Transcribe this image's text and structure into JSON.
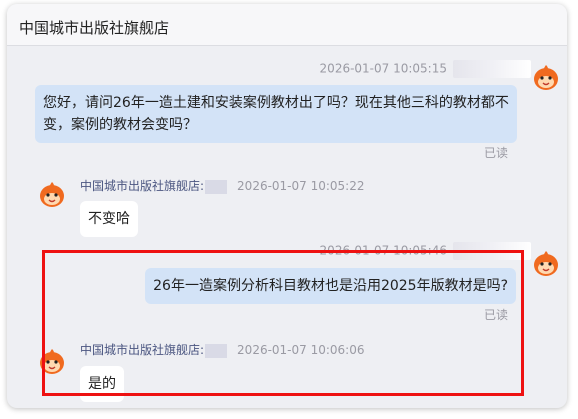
{
  "header": {
    "title": "中国城市出版社旗舰店"
  },
  "messages": {
    "m1": {
      "timestamp": "2026-01-07 10:05:15",
      "text": "您好，请问26年一造土建和安装案例教材出了吗？现在其他三科的教材都不变，案例的教材会变吗？",
      "status": "已读"
    },
    "m2": {
      "sender": "中国城市出版社旗舰店:",
      "timestamp": "2026-01-07 10:05:22",
      "text": "不变哈"
    },
    "m3": {
      "timestamp": "2026-01-07 10:05:46",
      "text": "26年一造案例分析科目教材也是沿用2025年版教材是吗?",
      "status": "已读"
    },
    "m4": {
      "sender": "中国城市出版社旗舰店:",
      "timestamp": "2026-01-07 10:06:06",
      "text": "是的"
    }
  },
  "colors": {
    "outgoing_bubble": "#d3e3f7",
    "incoming_bubble": "#ffffff",
    "highlight_border": "#ee1111",
    "avatar_orange": "#f06a1f"
  },
  "icons": {
    "avatar": "orange-mascot-avatar-icon"
  }
}
